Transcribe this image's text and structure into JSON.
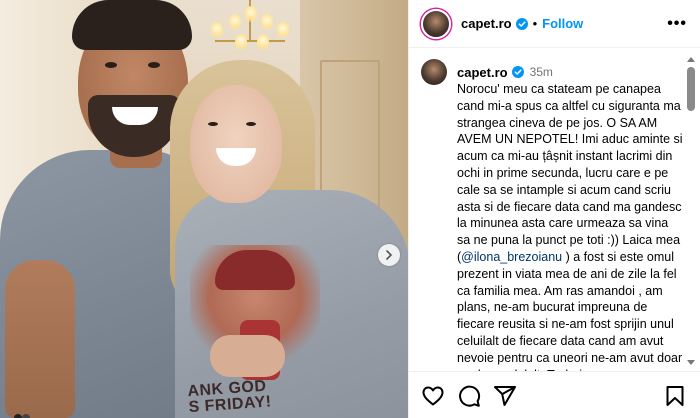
{
  "photo": {
    "shirt_print_text": "ANK GOD\nS FRIDAY!"
  },
  "header": {
    "username": "capet.ro",
    "separator": "•",
    "follow_label": "Follow",
    "more_label": "•••"
  },
  "caption": {
    "username": "capet.ro",
    "time": "35m",
    "text_before_mention": "Norocu' meu ca stateam pe canapea cand mi-a spus ca altfel cu siguranta ma strangea cineva de pe jos. O SA AM AVEM UN NEPOTEL! Imi aduc aminte si acum ca mi-au țâșnit instant lacrimi din ochi in prime secunda, lucru care e pe cale sa se intample si acum cand scriu asta si de fiecare data cand ma gandesc la minunea asta care urmeaza sa vina sa ne puna la punct pe toti :)) Laica mea (",
    "mention": "@ilona_brezoianu",
    "text_after_mention": " ) a fost si este omul prezent in viata mea de ani de zile la fel ca familia mea. Am ras amandoi , am plans, ne-am bucurat impreuna de fiecare reusita si ne-am fost sprijin unul celuilalt de fiecare data cand am avut nevoie pentru ca uneori ne-am avut doar unul pe celalalt. Trebuie sa recunosc ca am avut emotii cand a"
  },
  "actions": {
    "icons": [
      "heart-icon",
      "comment-icon",
      "share-icon",
      "bookmark-icon"
    ]
  },
  "colors": {
    "accent": "#0095f6",
    "mention": "#00376b",
    "muted": "#737373",
    "story_ring": "#d6249f"
  }
}
